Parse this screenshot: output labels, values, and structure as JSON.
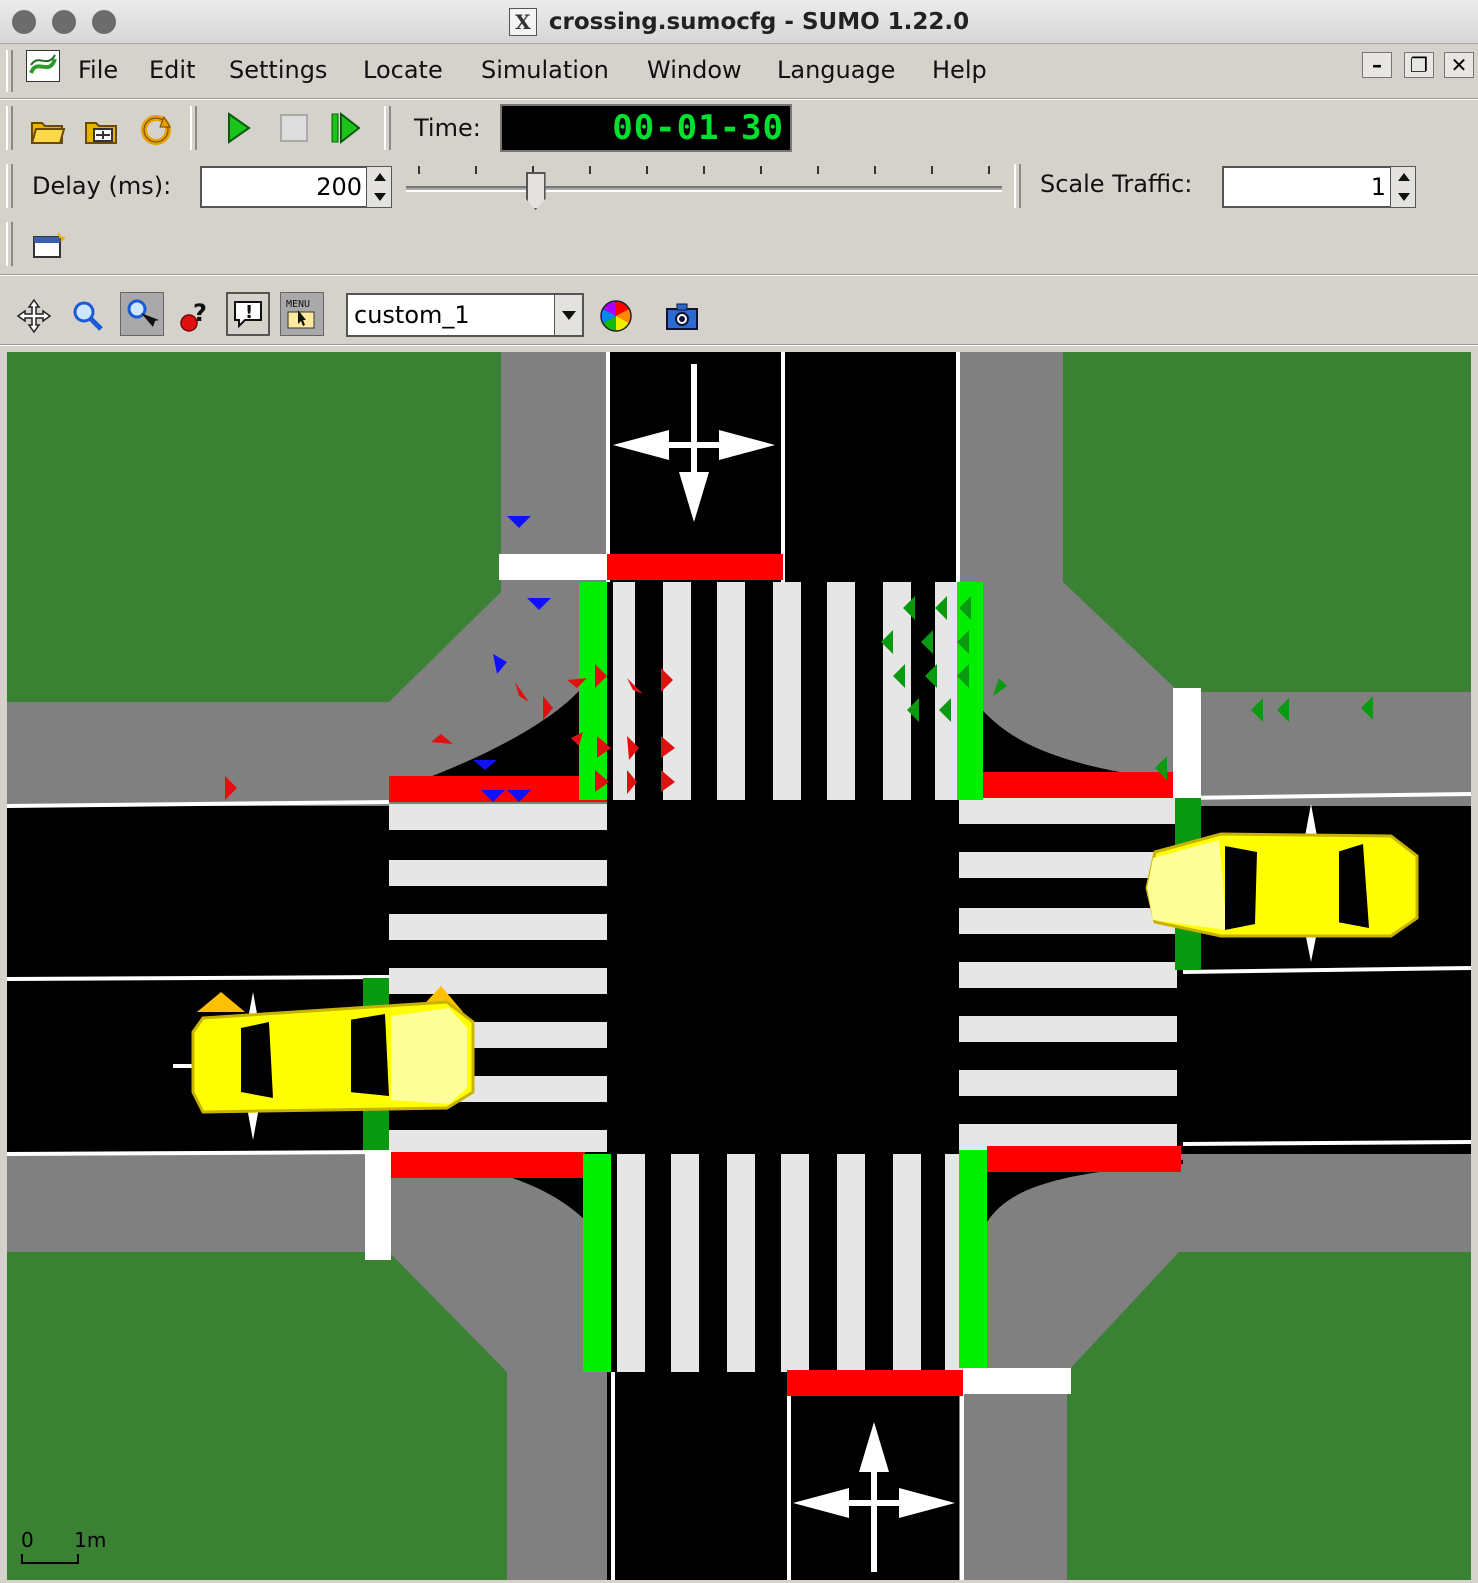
{
  "window": {
    "title": "crossing.sumocfg - SUMO 1.22.0",
    "x_badge": "X"
  },
  "menu": [
    "File",
    "Edit",
    "Settings",
    "Locate",
    "Simulation",
    "Window",
    "Language",
    "Help"
  ],
  "window_controls": {
    "minimize": "–",
    "restore": "❐",
    "close": "✕"
  },
  "toolbar": {
    "time_label": "Time:",
    "time_value": "00-01-30",
    "delay_label": "Delay (ms):",
    "delay_value": "200",
    "delay_slider_fraction": 0.21,
    "scale_label": "Scale Traffic:",
    "scale_value": "1"
  },
  "view_toolbar": {
    "scheme_value": "custom_1",
    "icons": [
      "recenter-view-icon",
      "zoom-icon",
      "locate-icon",
      "help-query-icon",
      "messages-icon",
      "menu-icon",
      "color-wheel-icon",
      "screenshot-camera-icon"
    ]
  },
  "scale_legend": {
    "zero": "0",
    "one": "1m"
  },
  "colors": {
    "grass": "#3a8134",
    "road": "#000000",
    "sidewalk": "#808080",
    "signal_red": "#ff0000",
    "signal_green": "#00ee00",
    "dark_green": "#0a9a12",
    "car": "#ffff00",
    "lcd": "#00e02e"
  }
}
